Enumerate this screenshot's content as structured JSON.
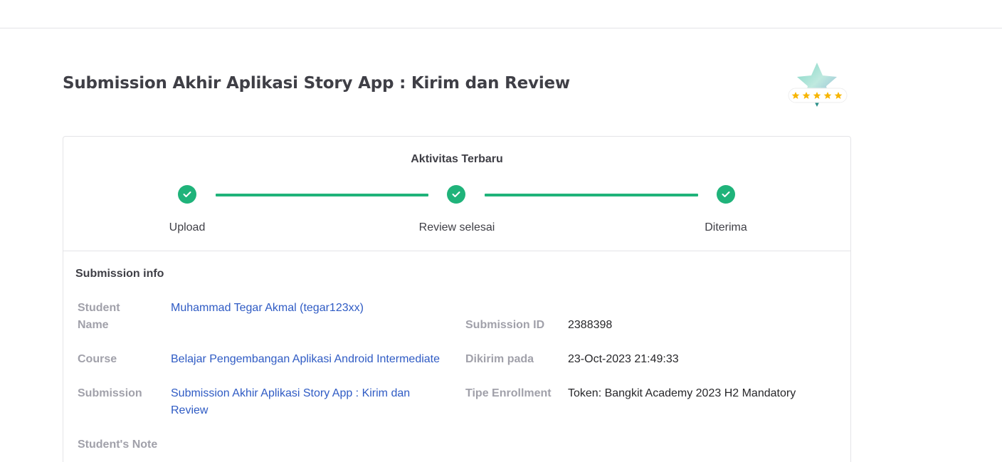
{
  "page": {
    "title": "Submission Akhir Aplikasi Story App : Kirim dan Review"
  },
  "badge": {
    "icon": "star-rating-badge-icon",
    "stars": 5
  },
  "activity": {
    "title": "Aktivitas Terbaru",
    "steps": [
      {
        "label": "Upload",
        "icon": "check-icon",
        "status": "done"
      },
      {
        "label": "Review selesai",
        "icon": "check-icon",
        "status": "done"
      },
      {
        "label": "Diterima",
        "icon": "check-icon",
        "status": "done"
      }
    ],
    "accent_color": "#1fb37a"
  },
  "submission_info": {
    "title": "Submission info",
    "student_name_label": "Student Name",
    "student_name_value": "Muhammad Tegar Akmal (tegar123xx)",
    "course_label": "Course",
    "course_value": "Belajar Pengembangan Aplikasi Android Intermediate",
    "submission_label": "Submission",
    "submission_value": "Submission Akhir Aplikasi Story App : Kirim dan Review",
    "student_note_label": "Student's Note",
    "submission_id_label": "Submission ID",
    "submission_id_value": "2388398",
    "sent_at_label": "Dikirim pada",
    "sent_at_value": "23-Oct-2023 21:49:33",
    "enrollment_type_label": "Tipe Enrollment",
    "enrollment_type_value": "Token: Bangkit Academy 2023 H2 Mandatory"
  }
}
